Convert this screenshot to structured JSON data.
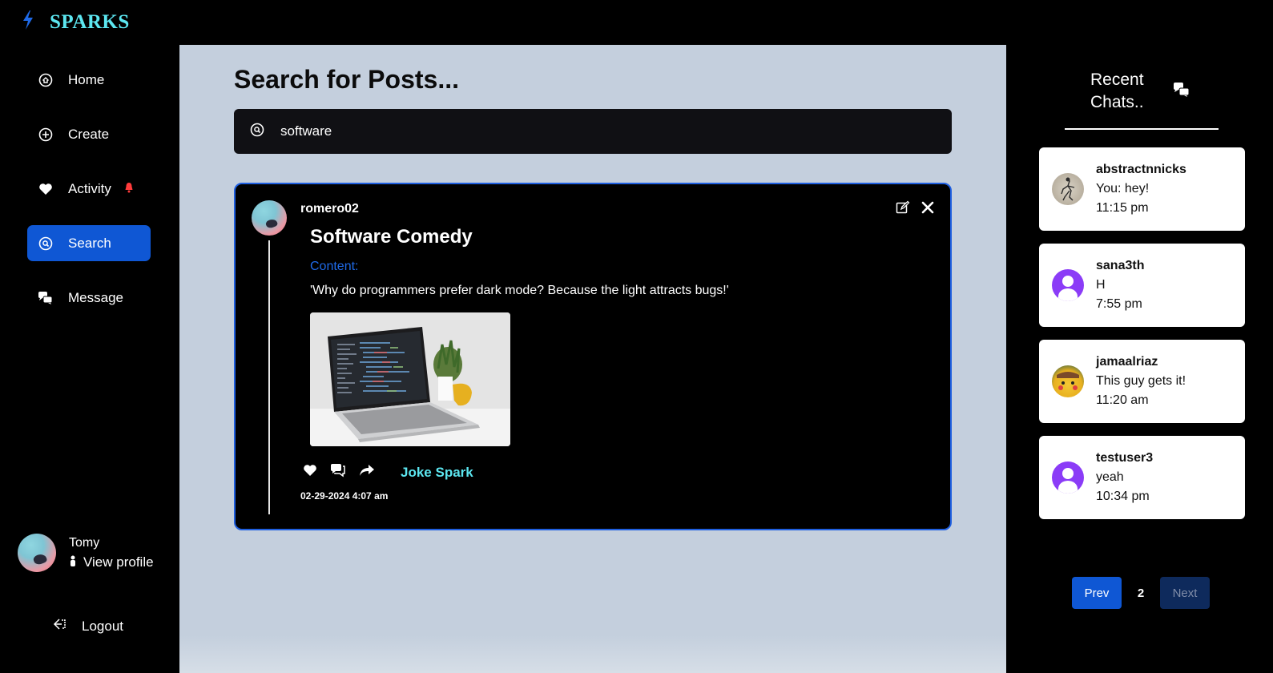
{
  "brand": {
    "name": "SPARKS",
    "icon": "lightning-icon",
    "accent": "#5ce6f0"
  },
  "sidebar": {
    "items": [
      {
        "label": "Home",
        "icon": "home-icon"
      },
      {
        "label": "Create",
        "icon": "plus-circle-icon"
      },
      {
        "label": "Activity",
        "icon": "heart-icon",
        "badge_icon": "bell-icon"
      },
      {
        "label": "Search",
        "icon": "search-icon",
        "active": true
      },
      {
        "label": "Message",
        "icon": "chat-icon"
      }
    ],
    "profile": {
      "name": "Tomy",
      "link_label": "View profile"
    },
    "logout_label": "Logout",
    "active_color": "#0f57d4"
  },
  "main": {
    "title": "Search for Posts...",
    "search": {
      "value": "software"
    },
    "post": {
      "username": "romero02",
      "title": "Software Comedy",
      "content_label": "Content:",
      "content_text": "'Why do programmers prefer dark mode? Because the light attracts bugs!'",
      "tag_prefix": "Joke",
      "tag_suffix": "Spark",
      "date": "02-29-2024 4:07 am",
      "border_color": "#1f5fe0"
    }
  },
  "recent_chats": {
    "title_line1": "Recent",
    "title_line2": "Chats..",
    "chats": [
      {
        "name": "abstractnnicks",
        "message": "You: hey!",
        "time": "11:15 pm"
      },
      {
        "name": "sana3th",
        "message": "H",
        "time": "7:55 pm"
      },
      {
        "name": "jamaalriaz",
        "message": "This guy gets it!",
        "time": "11:20 am"
      },
      {
        "name": "testuser3",
        "message": "yeah",
        "time": "10:34 pm"
      }
    ],
    "pager": {
      "prev_label": "Prev",
      "current_page": "2",
      "next_label": "Next"
    }
  }
}
